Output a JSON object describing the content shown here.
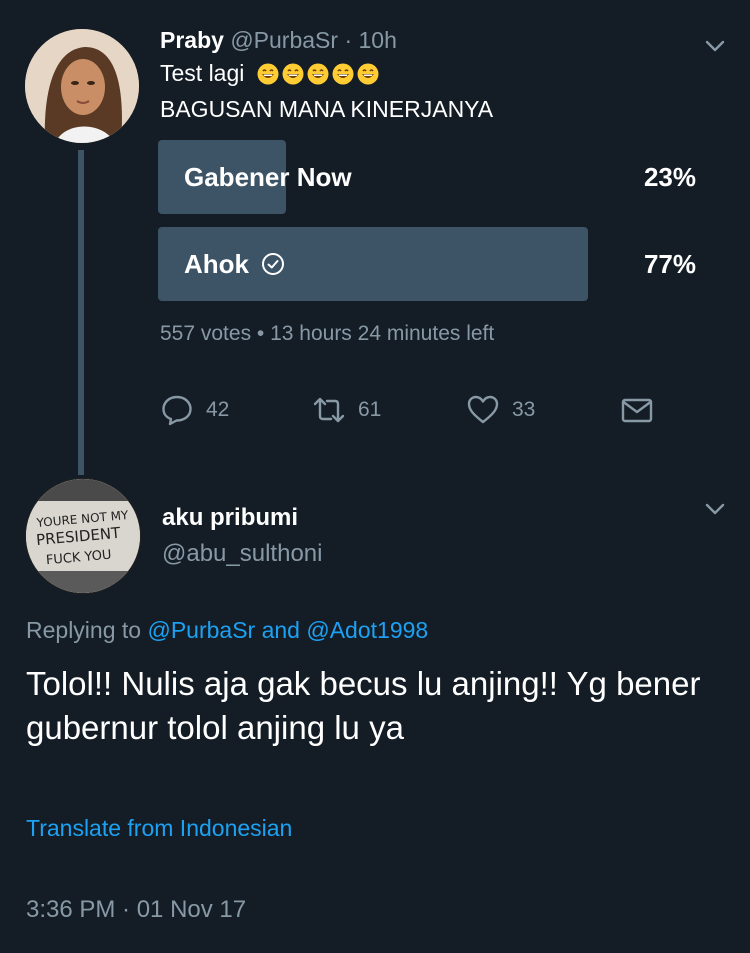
{
  "tweet": {
    "author_name": "Praby",
    "author_handle": "@PurbaSr",
    "separator": "·",
    "time": "10h",
    "line1": "Test lagi",
    "emoji_count": 5,
    "line2": "BAGUSAN MANA KINERJANYA",
    "poll": {
      "options": [
        {
          "label": "Gabener Now",
          "percent": "23%",
          "fraction": 0.23,
          "selected": false
        },
        {
          "label": "Ahok",
          "percent": "77%",
          "fraction": 0.77,
          "selected": true
        }
      ],
      "meta": "557 votes • 13 hours 24 minutes left"
    },
    "actions": {
      "reply_count": "42",
      "retweet_count": "61",
      "like_count": "33"
    }
  },
  "reply": {
    "author_name": "aku pribumi",
    "author_handle": "@abu_sulthoni",
    "avatar_sign_text": [
      "YOURE NOT MY",
      "PRESIDENT",
      "FUCK YOU"
    ],
    "replying_prefix": "Replying to",
    "replying_user1": "@PurbaSr",
    "replying_and": "and",
    "replying_user2": "@Adot1998",
    "body": "Tolol!! Nulis aja gak becus lu anjing!! Yg bener gubernur tolol anjing lu ya",
    "translate_label": "Translate from Indonesian",
    "timestamp": "3:36 PM · 01 Nov 17"
  },
  "colors": {
    "background": "#141d26",
    "muted": "#8899a6",
    "accent": "#1da1f2",
    "poll_bar": "#3d5466"
  }
}
